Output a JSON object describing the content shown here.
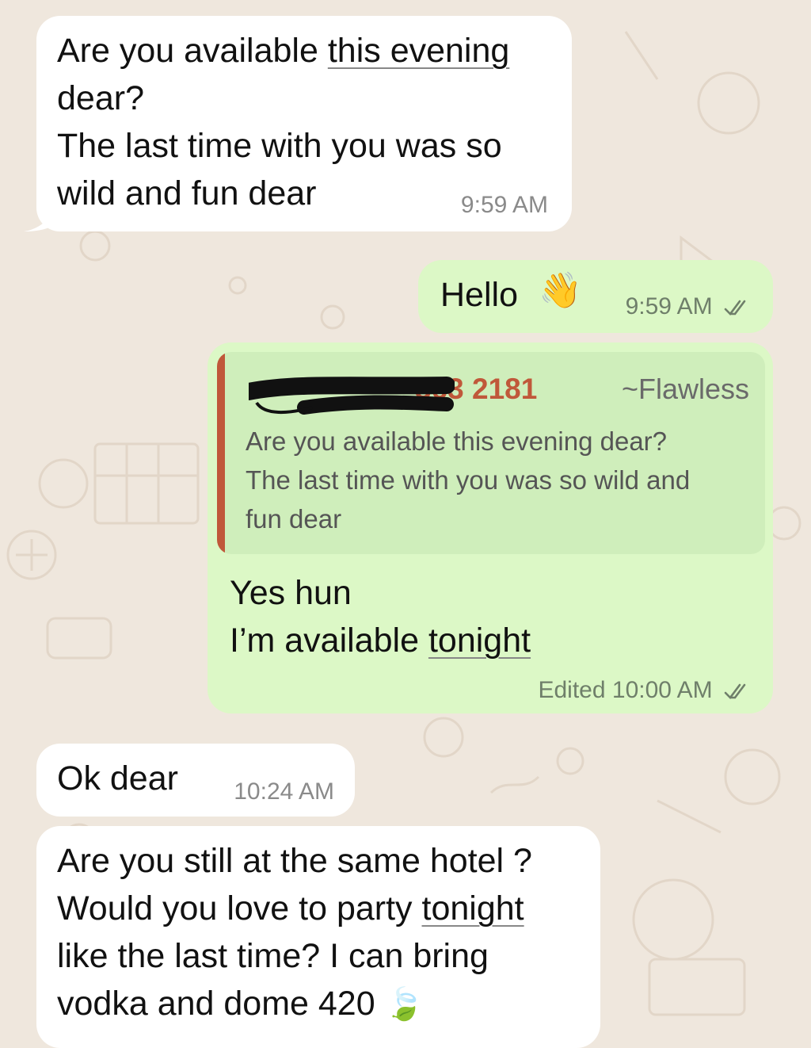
{
  "messages": [
    {
      "id": "m1",
      "direction": "incoming",
      "lines": [
        "Are you available ",
        "this evening",
        "dear?",
        "The last time with you was so",
        "wild and fun dear"
      ],
      "time": "9:59 AM"
    },
    {
      "id": "m2",
      "direction": "outgoing",
      "text": "Hello",
      "emoji": "👋",
      "time": "9:59 AM",
      "status": "read"
    },
    {
      "id": "m3",
      "direction": "outgoing",
      "quote": {
        "sender_visible": "363 2181",
        "alias": "~Flawless",
        "lines": [
          "Are you available this evening dear?",
          "The last time with you was so wild and",
          "fun dear"
        ]
      },
      "lines": [
        "Yes hun",
        "I’m available ",
        "tonight"
      ],
      "edited_label": "Edited",
      "time": "10:00 AM",
      "status": "read"
    },
    {
      "id": "m4",
      "direction": "incoming",
      "text": "Ok dear",
      "time": "10:24 AM"
    },
    {
      "id": "m5",
      "direction": "incoming",
      "lines": [
        "Are you still at the same hotel ?",
        "Would you love to party ",
        "tonight",
        "like the last time? I can bring",
        "vodka and dome 420"
      ],
      "emoji": "🍃"
    }
  ],
  "colors": {
    "background": "#efe7dd",
    "incoming": "#ffffff",
    "outgoing": "#dcf8c6",
    "quote_accent": "#c0583a"
  }
}
